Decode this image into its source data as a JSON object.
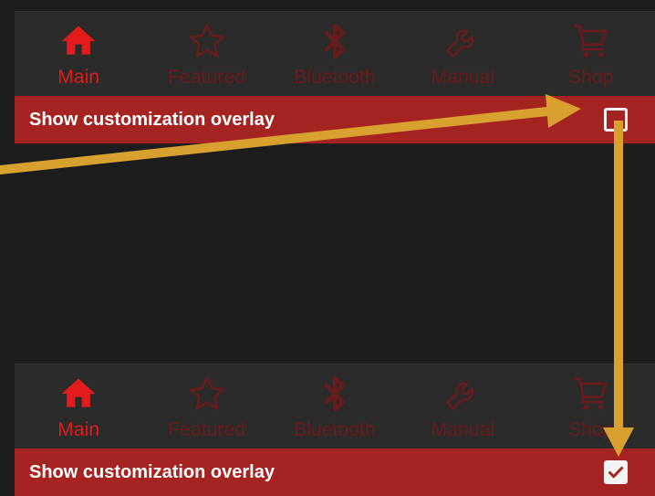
{
  "colors": {
    "background": "#1d1d1d",
    "nav_background": "#2b2b2b",
    "active": "#e31b1b",
    "inactive": "#6a1b1b",
    "overlay_bar": "#a52421",
    "annotation_arrow": "#d8a02f"
  },
  "panels": [
    {
      "nav": [
        {
          "label": "Main",
          "icon": "home-icon",
          "active": true
        },
        {
          "label": "Featured",
          "icon": "star-icon",
          "active": false
        },
        {
          "label": "Bluetooth",
          "icon": "bluetooth-icon",
          "active": false
        },
        {
          "label": "Manual",
          "icon": "wrench-icon",
          "active": false
        },
        {
          "label": "Shop",
          "icon": "cart-icon",
          "active": false
        }
      ],
      "overlay_label": "Show customization overlay",
      "checked": false
    },
    {
      "nav": [
        {
          "label": "Main",
          "icon": "home-icon",
          "active": true
        },
        {
          "label": "Featured",
          "icon": "star-icon",
          "active": false
        },
        {
          "label": "Bluetooth",
          "icon": "bluetooth-icon",
          "active": false
        },
        {
          "label": "Manual",
          "icon": "wrench-icon",
          "active": false
        },
        {
          "label": "Shop",
          "icon": "cart-icon",
          "active": false
        }
      ],
      "overlay_label": "Show customization overlay",
      "checked": true
    }
  ]
}
